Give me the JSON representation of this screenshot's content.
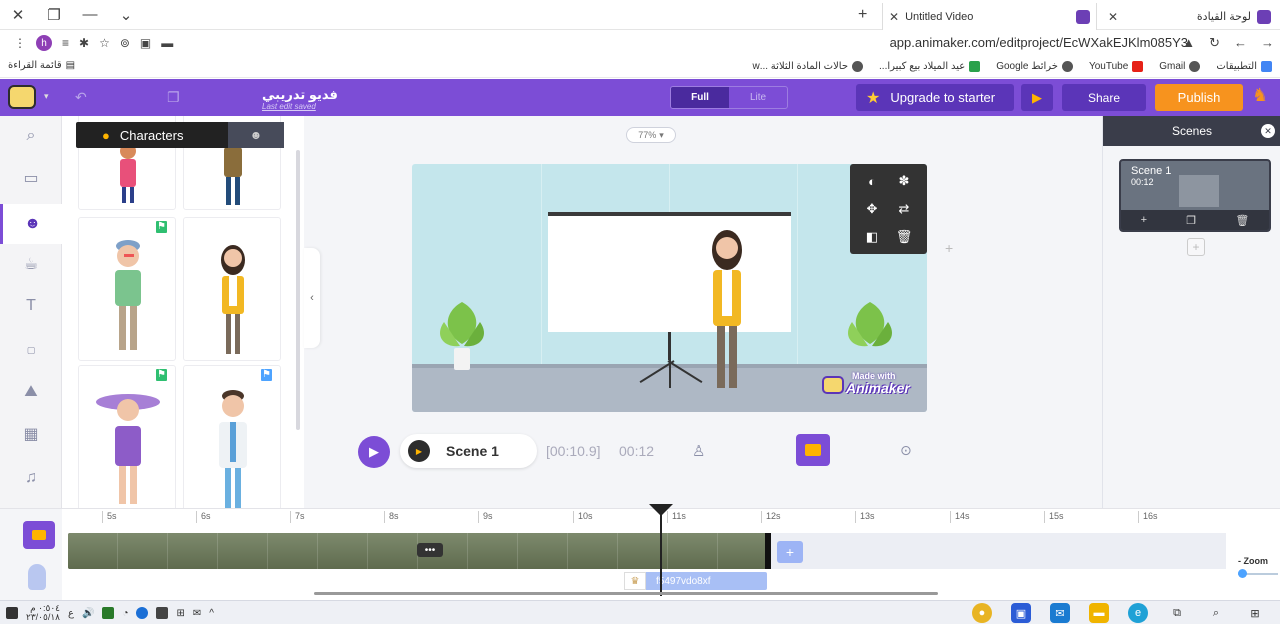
{
  "browser": {
    "tabs": [
      {
        "title": "Untitled Video",
        "active": true
      },
      {
        "title": "لوحة القيادة",
        "active": false
      }
    ],
    "url": "app.animaker.com/editproject/EcWXakEJKlm085Y3",
    "reading_list": "قائمة القراءة",
    "bookmarks": [
      "التطبيقات",
      "Gmail",
      "YouTube",
      "خرائط Google",
      "عيد الميلاد بيع كبيرا...",
      "حالات المادة الثلاثة ...w"
    ]
  },
  "appbar": {
    "project_title": "فديو تدريبي",
    "last_saved": "Last edit saved",
    "mode_full": "Full",
    "mode_lite": "Lite",
    "upgrade_label": "Upgrade to starter",
    "share_label": "Share",
    "publish_label": "Publish",
    "colors": {
      "brand": "#7c4dd6",
      "publish": "#f7931e",
      "accent": "#ffb400"
    }
  },
  "library": {
    "active_tab": "Characters"
  },
  "stage": {
    "zoom": "77%",
    "watermark_top": "Made with",
    "watermark_brand": "Animaker"
  },
  "playback": {
    "scene_name": "Scene 1",
    "current_time": "[00:10.9]",
    "total_time": "00:12"
  },
  "scenes": {
    "header": "Scenes",
    "items": [
      {
        "title": "Scene 1",
        "duration": "00:12"
      }
    ]
  },
  "timeline": {
    "ruler": [
      "5s",
      "6s",
      "7s",
      "8s",
      "9s",
      "10s",
      "11s",
      "12s",
      "13s",
      "14s",
      "15s",
      "16s"
    ],
    "character_id": "f5497vdo8xf",
    "zoom_label": "Zoom"
  },
  "taskbar": {
    "time": "٠:٥٠٤ م",
    "date": "٢٣/٠٥/١٨",
    "lang": "ع"
  }
}
